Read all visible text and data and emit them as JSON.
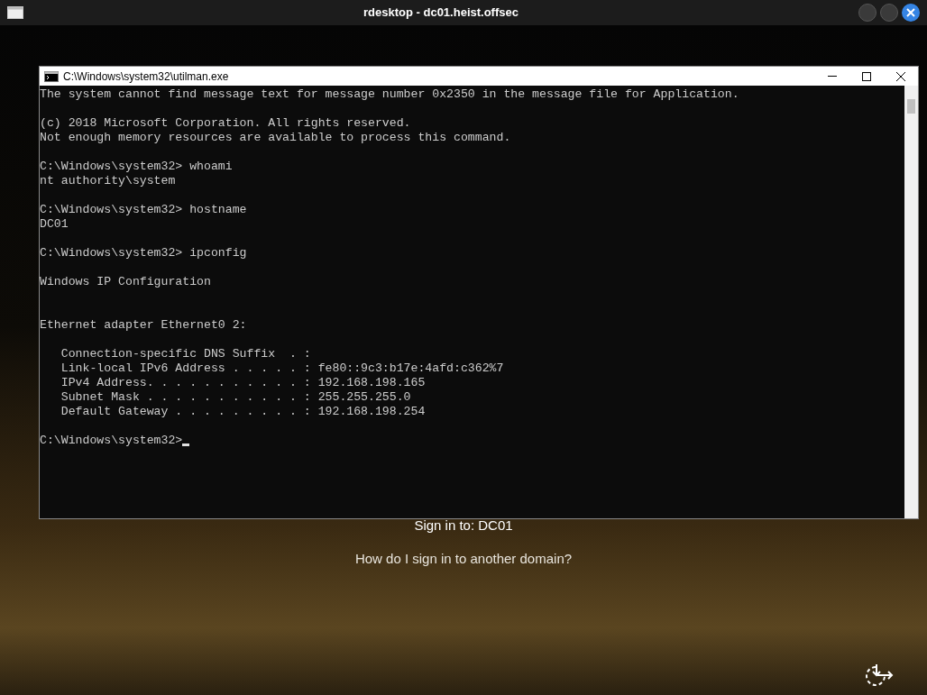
{
  "window": {
    "title": "rdesktop - dc01.heist.offsec"
  },
  "sign_in": {
    "target": "Sign in to: DC01",
    "other_domain_link": "How do I sign in to another domain?"
  },
  "console": {
    "title": "C:\\Windows\\system32\\utilman.exe",
    "lines": [
      {
        "kind": "output",
        "text": "The system cannot find message text for message number 0x2350 in the message file for Application."
      },
      {
        "kind": "blank"
      },
      {
        "kind": "output",
        "text": "(c) 2018 Microsoft Corporation. All rights reserved."
      },
      {
        "kind": "output",
        "text": "Not enough memory resources are available to process this command."
      },
      {
        "kind": "blank"
      },
      {
        "kind": "output",
        "text": "C:\\Windows\\system32> whoami"
      },
      {
        "kind": "output",
        "text": "nt authority\\system"
      },
      {
        "kind": "blank"
      },
      {
        "kind": "output",
        "text": "C:\\Windows\\system32> hostname"
      },
      {
        "kind": "output",
        "text": "DC01"
      },
      {
        "kind": "blank"
      },
      {
        "kind": "output",
        "text": "C:\\Windows\\system32> ipconfig"
      },
      {
        "kind": "blank"
      },
      {
        "kind": "output",
        "text": "Windows IP Configuration"
      },
      {
        "kind": "blank"
      },
      {
        "kind": "blank"
      },
      {
        "kind": "output",
        "text": "Ethernet adapter Ethernet0 2:"
      },
      {
        "kind": "blank"
      },
      {
        "kind": "output",
        "text": "   Connection-specific DNS Suffix  . :"
      },
      {
        "kind": "output",
        "text": "   Link-local IPv6 Address . . . . . : fe80::9c3:b17e:4afd:c362%7"
      },
      {
        "kind": "output",
        "text": "   IPv4 Address. . . . . . . . . . . : 192.168.198.165"
      },
      {
        "kind": "output",
        "text": "   Subnet Mask . . . . . . . . . . . : 255.255.255.0"
      },
      {
        "kind": "output",
        "text": "   Default Gateway . . . . . . . . . : 192.168.198.254"
      },
      {
        "kind": "blank"
      },
      {
        "kind": "prompt",
        "text": "C:\\Windows\\system32>",
        "cursor": true
      }
    ]
  }
}
